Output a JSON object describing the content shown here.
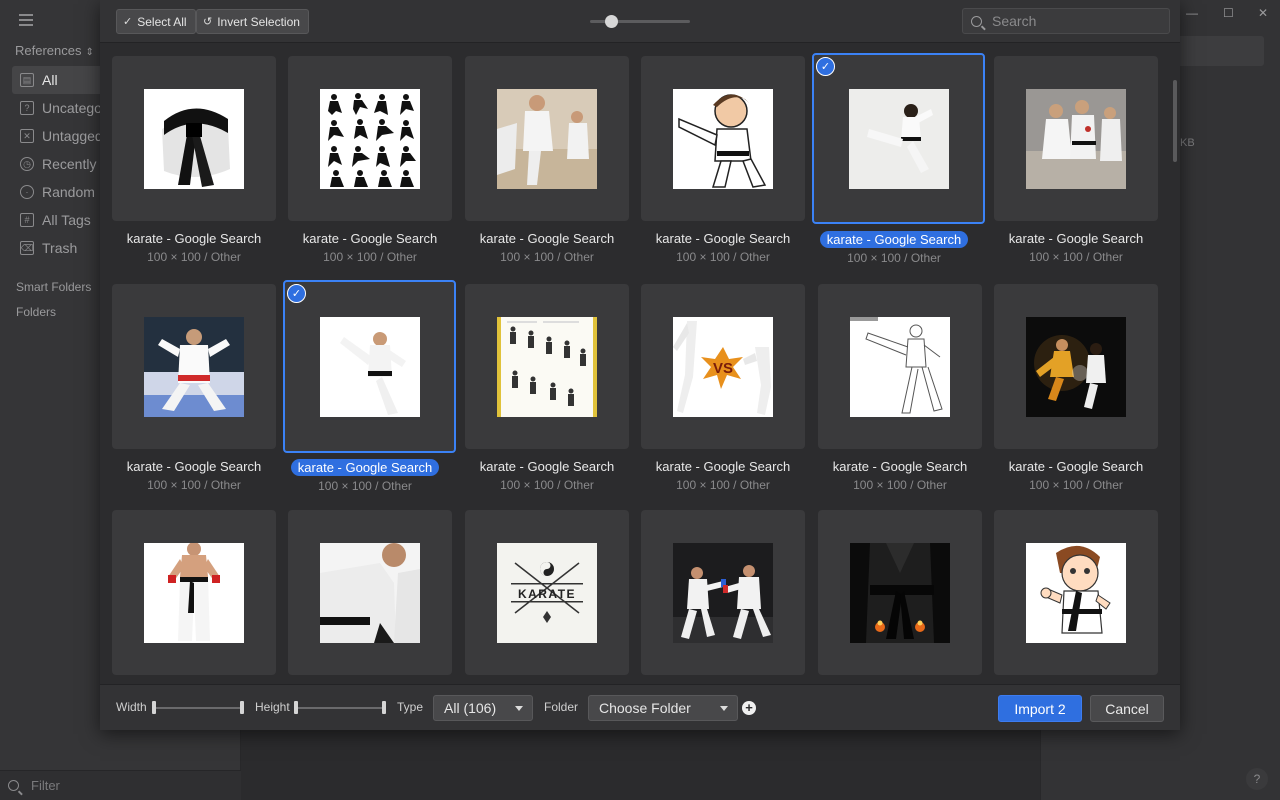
{
  "sidebar": {
    "library_label": "References",
    "nav": [
      {
        "label": "All",
        "icon": "all-icon",
        "active": true
      },
      {
        "label": "Uncategorized",
        "icon": "uncategorized-icon"
      },
      {
        "label": "Untagged",
        "icon": "untagged-icon"
      },
      {
        "label": "Recently Used",
        "icon": "clock-icon"
      },
      {
        "label": "Random",
        "icon": "bulb-icon"
      },
      {
        "label": "All Tags",
        "icon": "tag-icon"
      },
      {
        "label": "Trash",
        "icon": "trash-icon"
      }
    ],
    "smart_folders": "Smart Folders",
    "folders": "Folders",
    "filter_placeholder": "Filter"
  },
  "right_panel": {
    "size_suffix": "KB"
  },
  "window": {
    "minimize": "—",
    "maximize": "☐",
    "close": "✕",
    "help": "?"
  },
  "dialog": {
    "select_all": "Select All",
    "invert_selection": "Invert Selection",
    "search_placeholder": "Search",
    "items": [
      {
        "name": "karate - Google Search",
        "meta": "100 × 100 / Other",
        "selected": false,
        "thumb": "black-belt"
      },
      {
        "name": "karate - Google Search",
        "meta": "100 × 100 / Other",
        "selected": false,
        "thumb": "silhouettes"
      },
      {
        "name": "karate - Google Search",
        "meta": "100 × 100 / Other",
        "selected": false,
        "thumb": "kids-class"
      },
      {
        "name": "karate - Google Search",
        "meta": "100 × 100 / Other",
        "selected": false,
        "thumb": "cartoon-kick"
      },
      {
        "name": "karate - Google Search",
        "meta": "100 × 100 / Other",
        "selected": true,
        "thumb": "jump-kick"
      },
      {
        "name": "karate - Google Search",
        "meta": "100 × 100 / Other",
        "selected": false,
        "thumb": "dojo-class"
      },
      {
        "name": "karate - Google Search",
        "meta": "100 × 100 / Other",
        "selected": false,
        "thumb": "red-belt-pose"
      },
      {
        "name": "karate - Google Search",
        "meta": "100 × 100 / Other",
        "selected": true,
        "thumb": "high-kick"
      },
      {
        "name": "karate - Google Search",
        "meta": "100 × 100 / Other",
        "selected": false,
        "thumb": "kata-chart"
      },
      {
        "name": "karate - Google Search",
        "meta": "100 × 100 / Other",
        "selected": false,
        "thumb": "versus"
      },
      {
        "name": "karate - Google Search",
        "meta": "100 × 100 / Other",
        "selected": false,
        "thumb": "kick-sketch"
      },
      {
        "name": "karate - Google Search",
        "meta": "100 × 100 / Other",
        "selected": false,
        "thumb": "fire-fight"
      },
      {
        "name": "",
        "meta": "",
        "selected": false,
        "thumb": "shirtless-fighter"
      },
      {
        "name": "",
        "meta": "",
        "selected": false,
        "thumb": "close-spar"
      },
      {
        "name": "",
        "meta": "",
        "selected": false,
        "thumb": "karate-logo",
        "logo_text": "KARATE"
      },
      {
        "name": "",
        "meta": "",
        "selected": false,
        "thumb": "sparring-pair"
      },
      {
        "name": "",
        "meta": "",
        "selected": false,
        "thumb": "black-belt-fire"
      },
      {
        "name": "",
        "meta": "",
        "selected": false,
        "thumb": "cartoon-kid"
      }
    ],
    "footer": {
      "width_label": "Width",
      "height_label": "Height",
      "type_label": "Type",
      "type_value": "All (106)",
      "folder_label": "Folder",
      "folder_value": "Choose Folder",
      "import_label": "Import 2",
      "cancel_label": "Cancel"
    },
    "accent": "#2f6fe0"
  }
}
